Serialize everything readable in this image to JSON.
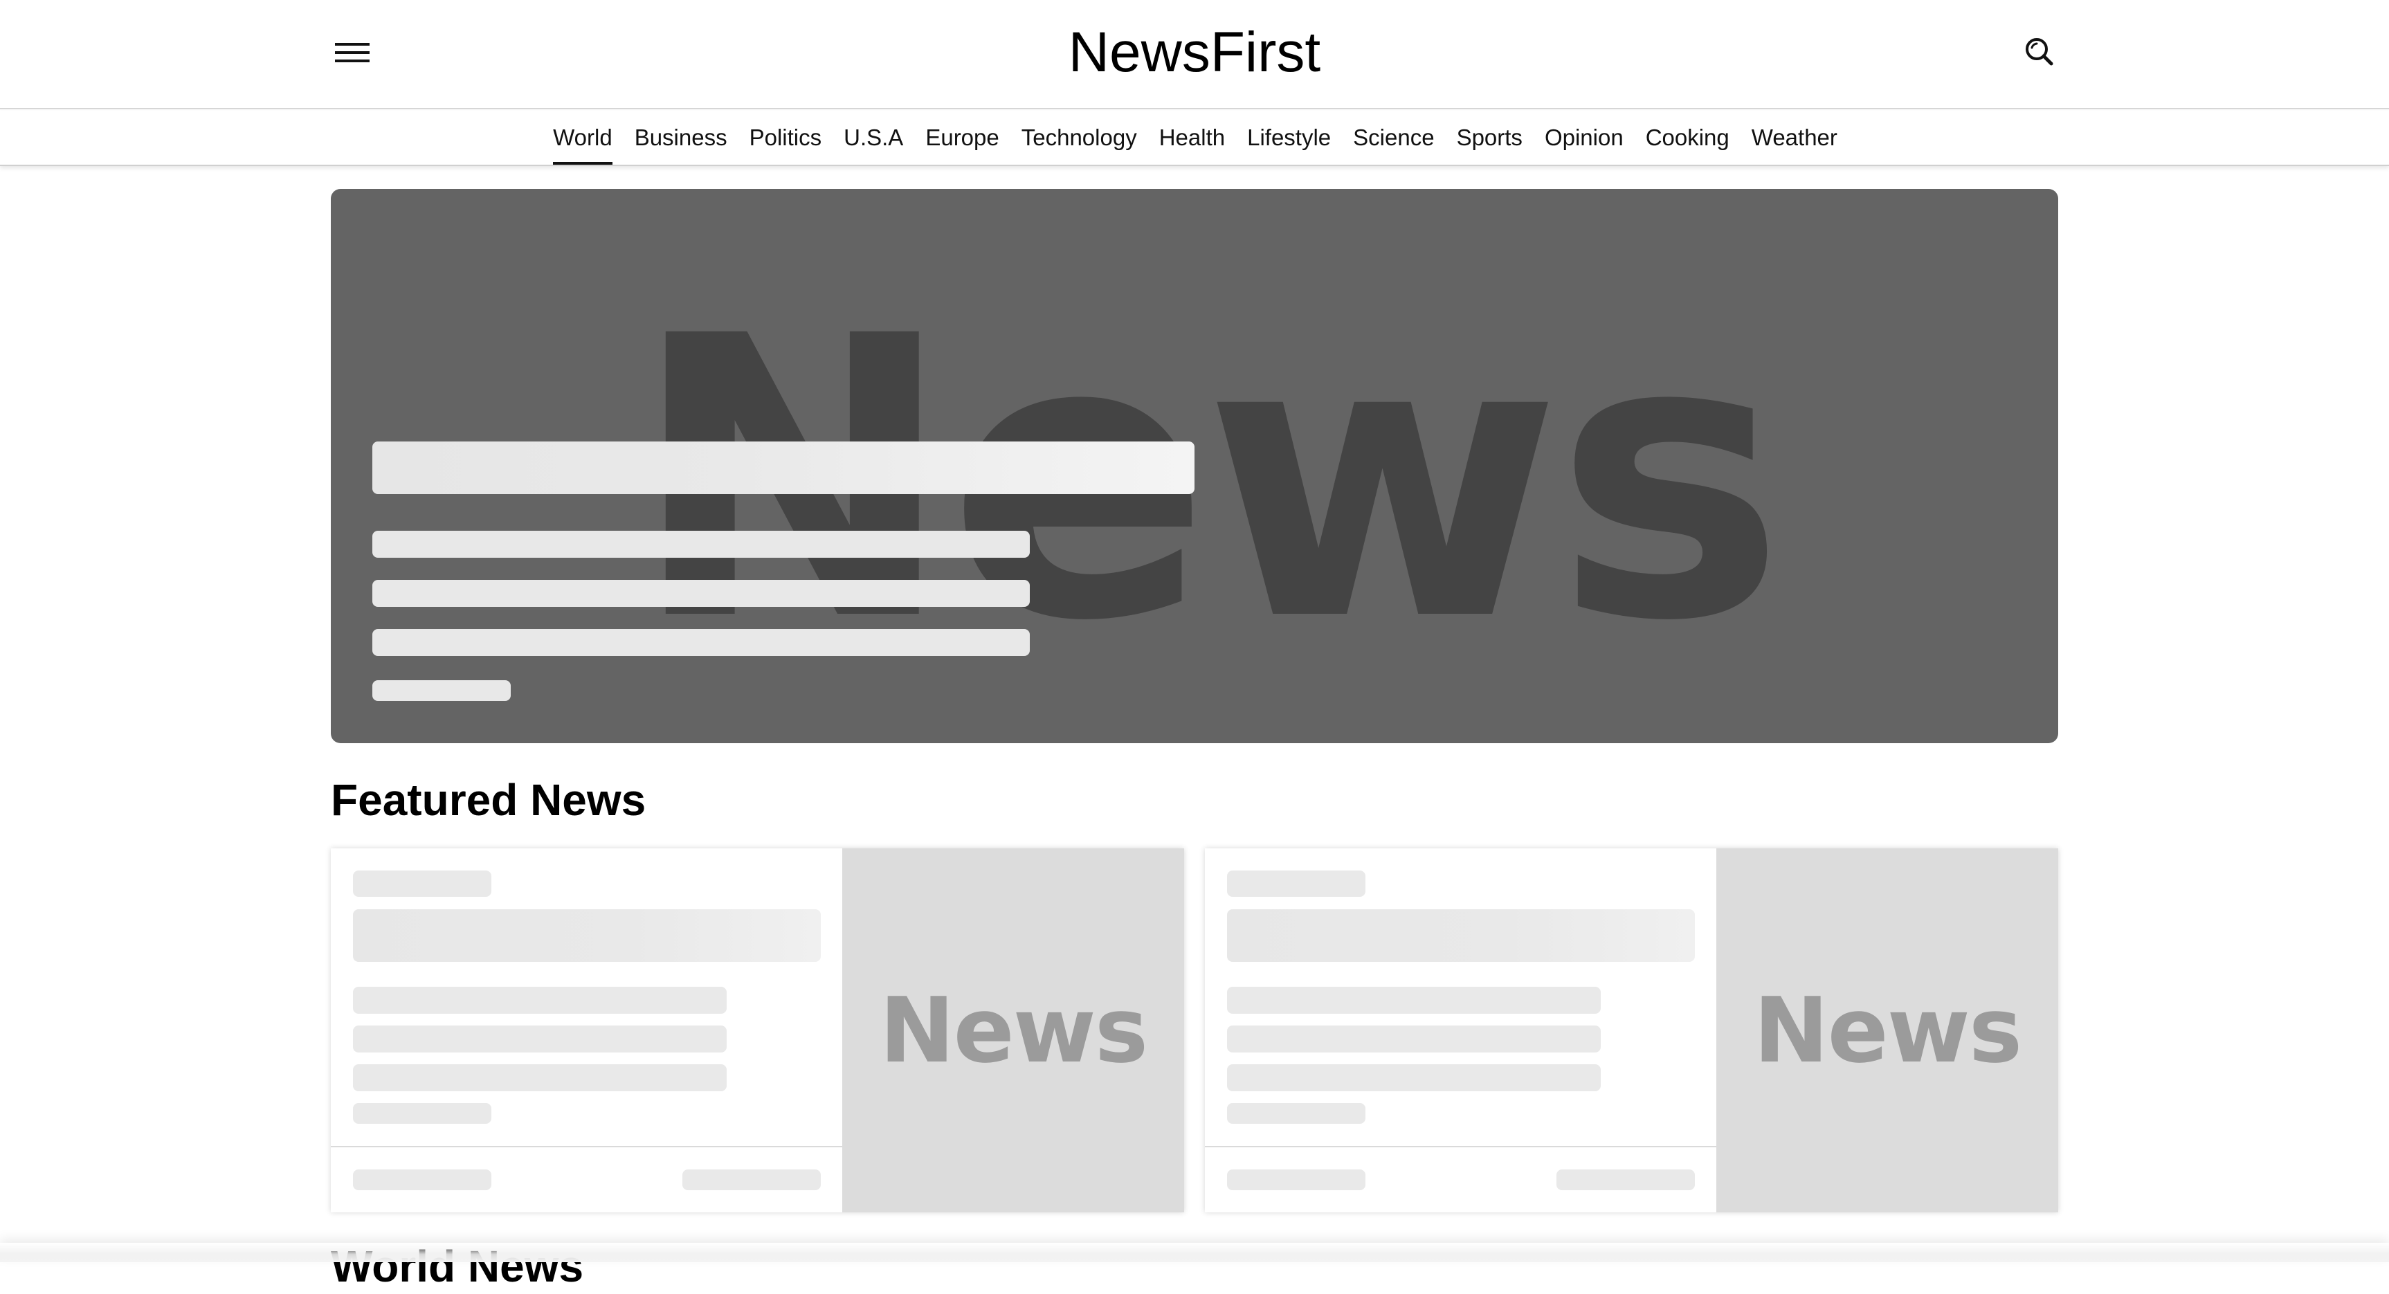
{
  "header": {
    "logo": "NewsFirst",
    "menu_icon": "hamburger-menu-icon",
    "search_icon": "search-icon"
  },
  "nav": {
    "items": [
      {
        "label": "World",
        "active": true
      },
      {
        "label": "Business"
      },
      {
        "label": "Politics"
      },
      {
        "label": "U.S.A"
      },
      {
        "label": "Europe"
      },
      {
        "label": "Technology"
      },
      {
        "label": "Health"
      },
      {
        "label": "Lifestyle"
      },
      {
        "label": "Science"
      },
      {
        "label": "Sports"
      },
      {
        "label": "Opinion"
      },
      {
        "label": "Cooking"
      },
      {
        "label": "Weather"
      }
    ]
  },
  "hero": {
    "image_label": "News",
    "state": "loading-skeleton"
  },
  "featured": {
    "title": "Featured News",
    "cards": [
      {
        "image_label": "News",
        "state": "loading-skeleton"
      },
      {
        "image_label": "News",
        "state": "loading-skeleton"
      }
    ]
  },
  "world": {
    "title": "World News"
  },
  "colors": {
    "hero_background": "#646464",
    "hero_watermark": "#444444",
    "card_image_background": "#dcdcdc",
    "card_image_text": "#9b9b9b",
    "skeleton": "#e8e8e8"
  }
}
